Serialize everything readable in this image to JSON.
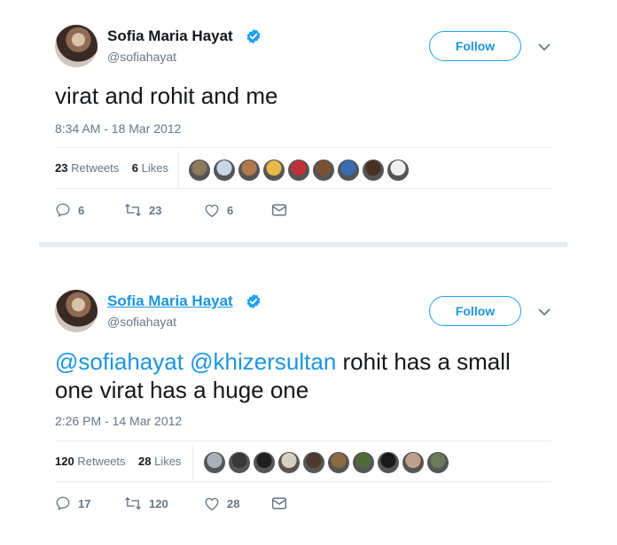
{
  "tweets": [
    {
      "name": "Sofia Maria Hayat",
      "handle": "@sofiahayat",
      "follow_label": "Follow",
      "text": "virat and rohit and me",
      "timestamp": "8:34 AM - 18 Mar 2012",
      "retweets_count": "23",
      "retweets_label": "Retweets",
      "likes_count": "6",
      "likes_label": "Likes",
      "reply_count": "6",
      "retweet_count": "23",
      "like_count": "6",
      "liker_colors": [
        "#8c7a5a",
        "#c8d6e8",
        "#b07a4a",
        "#e6b84a",
        "#c0303a",
        "#7a5030",
        "#3a6ab0",
        "#4a3020",
        "#f0f0f0"
      ]
    },
    {
      "name": "Sofia Maria Hayat",
      "handle": "@sofiahayat",
      "follow_label": "Follow",
      "mention_1": "@sofiahayat",
      "mention_2": "@khizersultan",
      "text": " rohit has a small one virat has a huge one",
      "timestamp": "2:26 PM - 14 Mar 2012",
      "retweets_count": "120",
      "retweets_label": "Retweets",
      "likes_count": "28",
      "likes_label": "Likes",
      "reply_count": "17",
      "retweet_count": "120",
      "like_count": "28",
      "liker_colors": [
        "#a8b0b8",
        "#3a3a3a",
        "#202020",
        "#d8d0c0",
        "#4a3a30",
        "#8a6a40",
        "#506a3a",
        "#1a1a1a",
        "#c0a090",
        "#6a7a5a"
      ]
    }
  ],
  "colors": {
    "accent": "#1da1f2",
    "link": "#1b95e0",
    "muted": "#657786",
    "divider": "#e6ecf0"
  },
  "icons": [
    "verified-badge-icon",
    "chevron-down-icon",
    "reply-icon",
    "retweet-icon",
    "heart-icon",
    "envelope-icon"
  ]
}
